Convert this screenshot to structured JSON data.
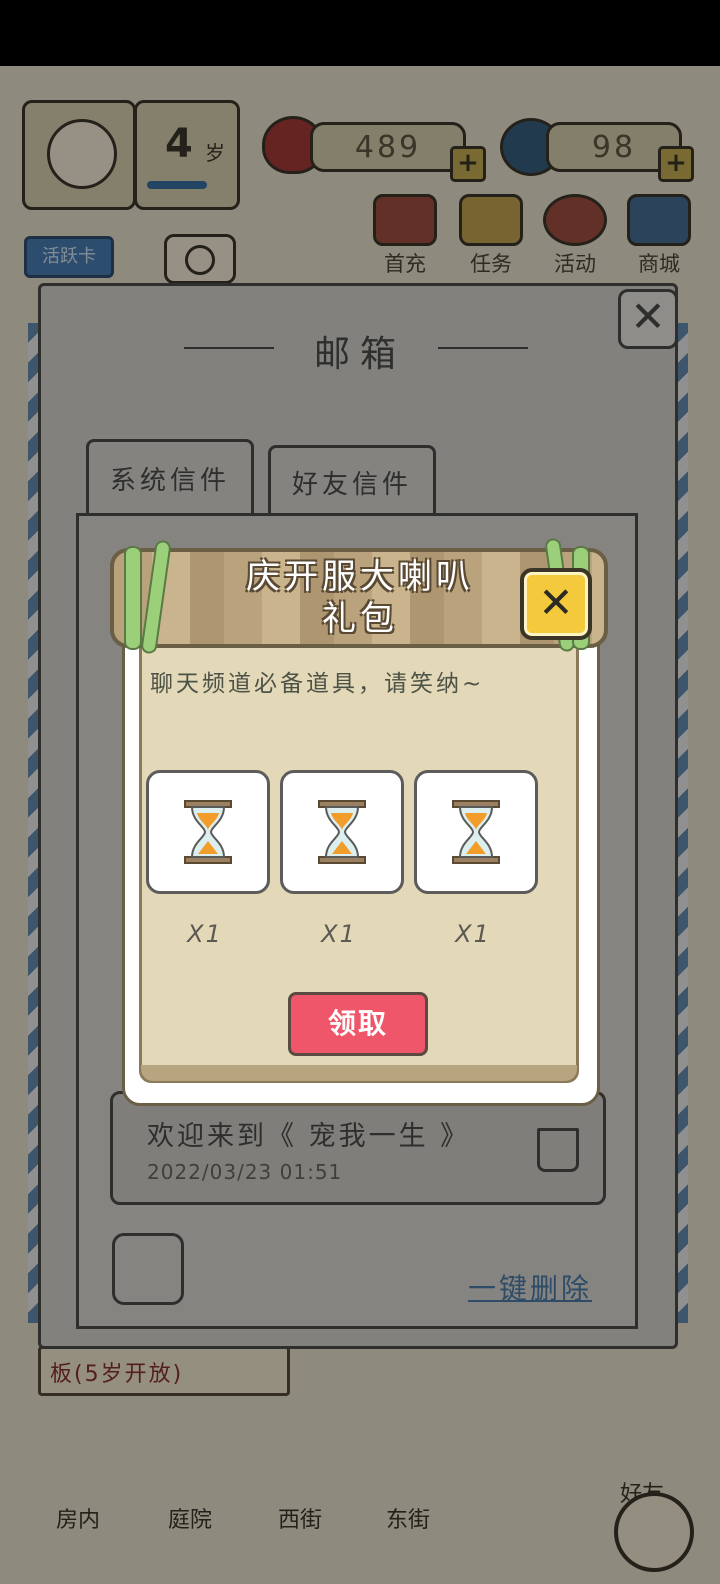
{
  "hud": {
    "age_value": "4",
    "age_unit": "岁",
    "badge": "活跃卡",
    "hearts": "489",
    "coins": "98",
    "plus": "+",
    "icons": [
      {
        "name": "gift-icon",
        "label": "首充"
      },
      {
        "name": "task-icon",
        "label": "任务"
      },
      {
        "name": "balloon-icon",
        "label": "活动"
      },
      {
        "name": "shop-icon",
        "label": "商城"
      }
    ]
  },
  "mailbox": {
    "title": "邮箱",
    "tabs": [
      "系统信件",
      "好友信件"
    ],
    "last_mail": {
      "subject": "欢迎来到《 宠我一生 》",
      "time": "2022/03/23 01:51"
    },
    "delete_all": "一键删除"
  },
  "background": {
    "hint": "板(5岁开放)",
    "friends": "好友",
    "nav": [
      "房内",
      "庭院",
      "西街",
      "东街"
    ]
  },
  "popup": {
    "title_line1": "庆开服大喇叭",
    "title_line2": "礼包",
    "description": "聊天频道必备道具，请笑纳~",
    "items": [
      {
        "icon": "hourglass-icon",
        "qty": "X1"
      },
      {
        "icon": "hourglass-icon",
        "qty": "X1"
      },
      {
        "icon": "hourglass-icon",
        "qty": "X1"
      }
    ],
    "claim_label": "领取",
    "colors": {
      "claim": "#f0566a",
      "close": "#f4c93b",
      "panel": "#e3d8b8",
      "sign": "#c2ab84"
    }
  }
}
